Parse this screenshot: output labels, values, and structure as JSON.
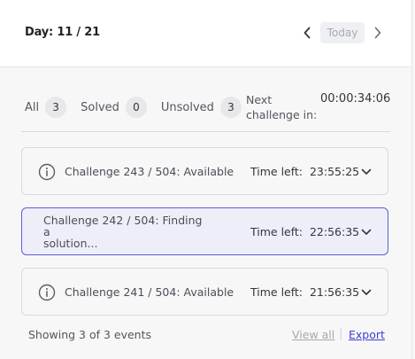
{
  "header": {
    "day_label": "Day: 11 / 21",
    "today_label": "Today"
  },
  "filters": {
    "all_label": "All",
    "all_count": "3",
    "solved_label": "Solved",
    "solved_count": "0",
    "unsolved_label": "Unsolved",
    "unsolved_count": "3",
    "next_label_line1": "Next",
    "next_label_line2": "challenge in:",
    "next_countdown": "00:00:34:06"
  },
  "challenges": [
    {
      "title": "Challenge 243 / 504: Available",
      "time_left": "Time left:  23:55:25",
      "icon": "info-icon"
    },
    {
      "title_line1": "Challenge 242 / 504: Finding a",
      "title_line2": "solution...",
      "time_left": "Time left:  22:56:35"
    },
    {
      "title": "Challenge 241 / 504: Available",
      "time_left": "Time left:  21:56:35",
      "icon": "info-icon"
    }
  ],
  "footer": {
    "status": "Showing 3 of 3 events",
    "view_all": "View all",
    "separator": "|",
    "export": "Export"
  },
  "colors": {
    "accent": "#3a3fd0",
    "active_border": "#5b5fd6",
    "active_bg": "#eeeef9"
  }
}
